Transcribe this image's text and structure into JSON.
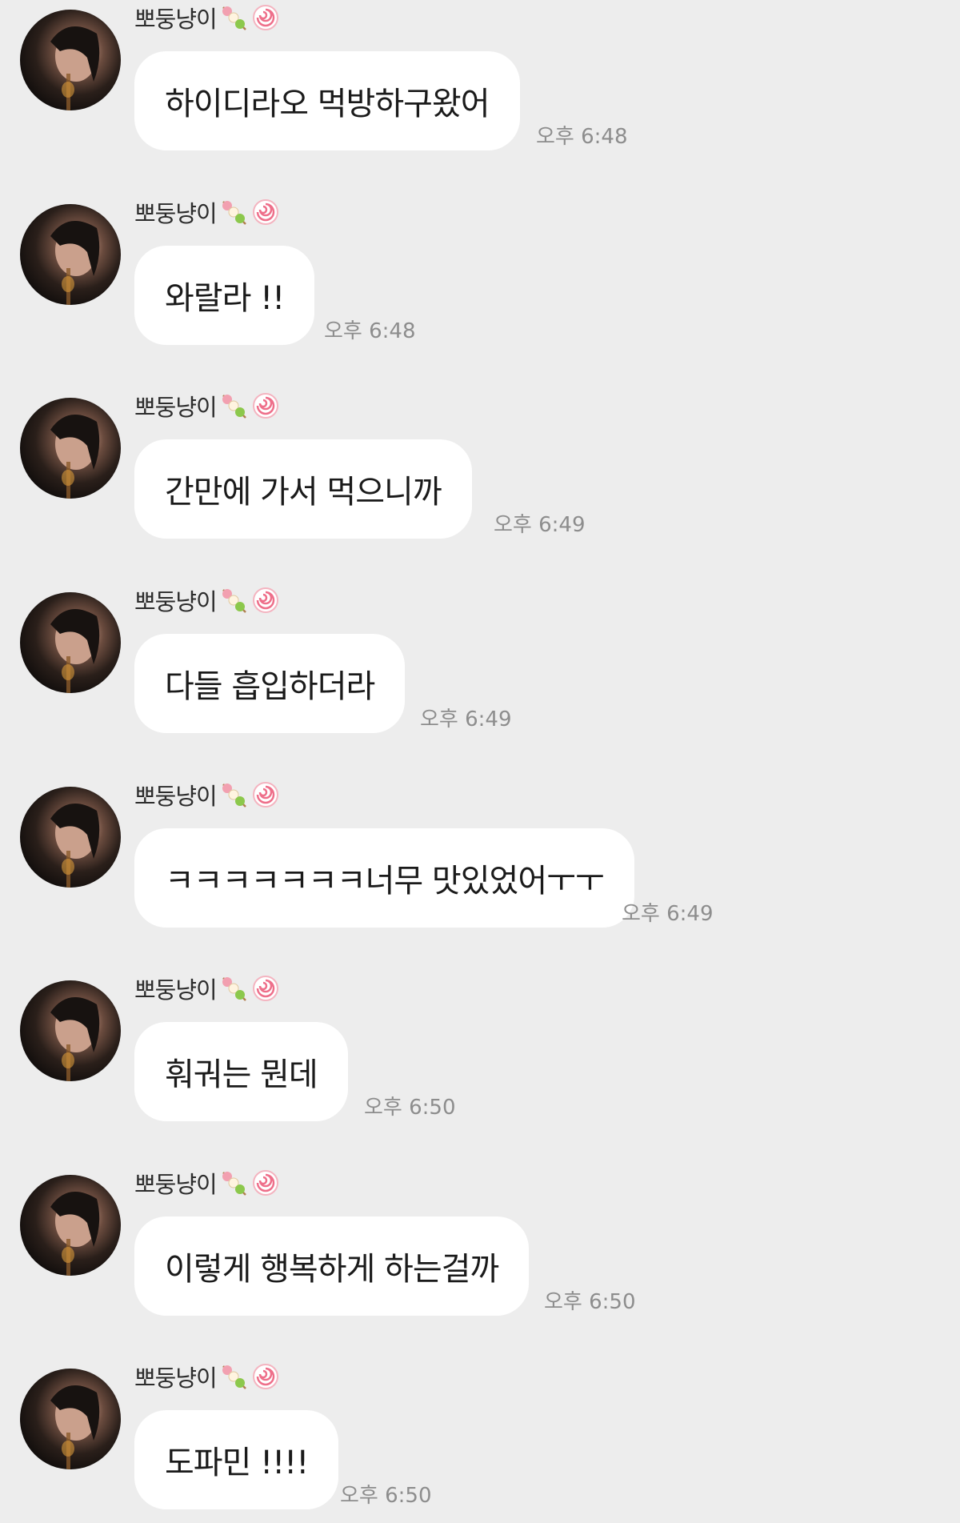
{
  "sender_name": "뽀둥냥이",
  "messages": [
    {
      "text": "하이디라오 먹방하구왔어",
      "time": "오후 6:48"
    },
    {
      "text": "와랄라 !!",
      "time": "오후 6:48"
    },
    {
      "text": "간만에 가서 먹으니까",
      "time": "오후 6:49"
    },
    {
      "text": "다들 흡입하더라",
      "time": "오후 6:49"
    },
    {
      "text": "ㅋㅋㅋㅋㅋㅋㅋ너무 맛있었어ㅜㅜ",
      "time": "오후 6:49"
    },
    {
      "text": "훠궈는 뭔데",
      "time": "오후 6:50"
    },
    {
      "text": "이렇게 행복하게 하는걸까",
      "time": "오후 6:50"
    },
    {
      "text": "도파민 !!!!",
      "time": "오후 6:50"
    }
  ],
  "icons": {
    "dango": "dango-emoji-icon",
    "narutomaki": "narutomaki-emoji-icon"
  },
  "colors": {
    "background": "#ededed",
    "bubble": "#ffffff",
    "time": "#8d8d8d"
  }
}
